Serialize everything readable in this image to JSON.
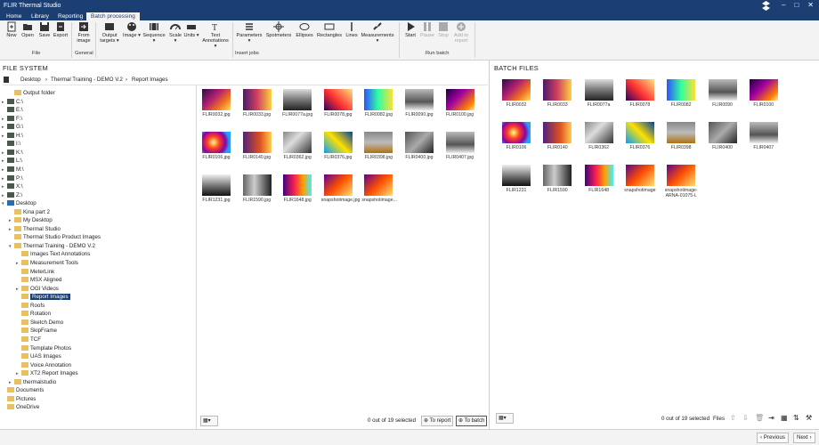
{
  "app": {
    "title": "FLIR Thermal Studio"
  },
  "menu_tabs": [
    {
      "label": "Home"
    },
    {
      "label": "Library"
    },
    {
      "label": "Reporting"
    },
    {
      "label": "Batch processing",
      "active": true
    }
  ],
  "ribbon": {
    "file": {
      "new": "New",
      "open": "Open",
      "save": "Save",
      "export": "Export",
      "group": "File"
    },
    "general": {
      "from_image_1": "From",
      "from_image_2": "image",
      "group": "General"
    },
    "insert": {
      "output_targets_1": "Output",
      "output_targets_2": "targets ▾",
      "image": "Image ▾",
      "sequence": "Sequence ▾",
      "scale": "Scale ▾",
      "units": "Units ▾",
      "text_annotations_1": "Text",
      "text_annotations_2": "Annotations ▾",
      "parameters": "Parameters ▾",
      "spotmeters": "Spotmeters",
      "ellipses": "Ellipses",
      "rectangles": "Rectangles",
      "lines": "Lines",
      "measurements": "Measurements ▾",
      "group": "Insert jobs"
    },
    "run": {
      "start": "Start",
      "pause": "Pause",
      "stop": "Stop",
      "add_1": "Add to",
      "add_2": "report",
      "group": "Run batch"
    }
  },
  "file_system": {
    "title": "FILE SYSTEM",
    "breadcrumb": [
      "Desktop",
      "Thermal Training - DEMO V.2",
      "Report Images"
    ],
    "tree": [
      {
        "label": "Output folder",
        "icon": "folder-icon"
      },
      {
        "label": "C:\\",
        "icon": "drive-icon"
      },
      {
        "label": "E:\\",
        "icon": "drive-icon"
      },
      {
        "label": "F:\\",
        "icon": "drive-icon"
      },
      {
        "label": "G:\\",
        "icon": "drive-icon"
      },
      {
        "label": "H:\\",
        "icon": "drive-icon"
      },
      {
        "label": "I:\\",
        "icon": "drive-icon"
      },
      {
        "label": "K:\\",
        "icon": "drive-icon"
      },
      {
        "label": "L:\\",
        "icon": "drive-icon"
      },
      {
        "label": "M:\\",
        "icon": "drive-icon"
      },
      {
        "label": "P:\\",
        "icon": "drive-icon"
      },
      {
        "label": "X:\\",
        "icon": "drive-icon"
      },
      {
        "label": "Z:\\",
        "icon": "drive-icon"
      },
      {
        "label": "Desktop",
        "icon": "desktop-icon"
      },
      {
        "label": "Kina part 2",
        "icon": "folder-icon"
      },
      {
        "label": "My Desktop",
        "icon": "folder-icon"
      },
      {
        "label": "Thermal Studio",
        "icon": "folder-icon"
      },
      {
        "label": "Thermal Studio Product Images",
        "icon": "folder-icon"
      },
      {
        "label": "Thermal Training - DEMO V.2",
        "icon": "folder-icon"
      },
      {
        "label": "Images Text Annotations",
        "icon": "folder-icon"
      },
      {
        "label": "Measurement Tools",
        "icon": "folder-icon"
      },
      {
        "label": "MeterLink",
        "icon": "folder-icon"
      },
      {
        "label": "MSX Aligned",
        "icon": "folder-icon"
      },
      {
        "label": "OGI Videos",
        "icon": "folder-icon"
      },
      {
        "label": "Report Images",
        "icon": "folder-icon"
      },
      {
        "label": "Roofs",
        "icon": "folder-icon"
      },
      {
        "label": "Rotation",
        "icon": "folder-icon"
      },
      {
        "label": "Sketch Demo",
        "icon": "folder-icon"
      },
      {
        "label": "SkipFrame",
        "icon": "folder-icon"
      },
      {
        "label": "TCF",
        "icon": "folder-icon"
      },
      {
        "label": "Template Photos",
        "icon": "folder-icon"
      },
      {
        "label": "UAS Images",
        "icon": "folder-icon"
      },
      {
        "label": "Voice Annotation",
        "icon": "folder-icon"
      },
      {
        "label": "XT2 Report Images",
        "icon": "folder-icon"
      },
      {
        "label": "thermalstudio",
        "icon": "folder-icon"
      },
      {
        "label": "Documents",
        "icon": "folder-icon"
      },
      {
        "label": "Pictures",
        "icon": "folder-icon"
      },
      {
        "label": "OneDrive",
        "icon": "folder-icon"
      }
    ],
    "files": [
      {
        "name": "FLIR0032.jpg"
      },
      {
        "name": "FLIR0033.jpg"
      },
      {
        "name": "FLIR0077a.jpg"
      },
      {
        "name": "FLIR0078.jpg"
      },
      {
        "name": "FLIR0082.jpg"
      },
      {
        "name": "FLIR0090.jpg"
      },
      {
        "name": "FLIR0100.jpg"
      },
      {
        "name": "FLIR0106.jpg"
      },
      {
        "name": "FLIR0140.jpg"
      },
      {
        "name": "FLIR0362.jpg"
      },
      {
        "name": "FLIR0376.jpg"
      },
      {
        "name": "FLIR0398.jpg"
      },
      {
        "name": "FLIR0400.jpg"
      },
      {
        "name": "FLIR0407.jpg"
      },
      {
        "name": "FLIR1231.jpg"
      },
      {
        "name": "FLIR1590.jpg"
      },
      {
        "name": "FLIR1648.jpg"
      },
      {
        "name": "snapshotimage.jpg"
      },
      {
        "name": "snapshotimage..."
      }
    ],
    "selection_status": "0 out of 19 selected",
    "to_report": "To report",
    "to_batch": "To batch"
  },
  "batch_files": {
    "title": "BATCH FILES",
    "files": [
      {
        "name": "FLIR0032"
      },
      {
        "name": "FLIR0033"
      },
      {
        "name": "FLIR0077a"
      },
      {
        "name": "FLIR0078"
      },
      {
        "name": "FLIR0082"
      },
      {
        "name": "FLIR0090"
      },
      {
        "name": "FLIR0100"
      },
      {
        "name": "FLIR0106"
      },
      {
        "name": "FLIR0140"
      },
      {
        "name": "FLIR0362"
      },
      {
        "name": "FLIR0376"
      },
      {
        "name": "FLIR0398"
      },
      {
        "name": "FLIR0400"
      },
      {
        "name": "FLIR0407"
      },
      {
        "name": "FLIR1231"
      },
      {
        "name": "FLIR1590"
      },
      {
        "name": "FLIR1648"
      },
      {
        "name": "snapshotimage"
      },
      {
        "name": "snapshotimage-ARNA-01075-L"
      }
    ],
    "selection_status": "0 out of 19 selected",
    "files_label": "Files"
  },
  "nav": {
    "previous": "Previous",
    "next": "Next"
  }
}
